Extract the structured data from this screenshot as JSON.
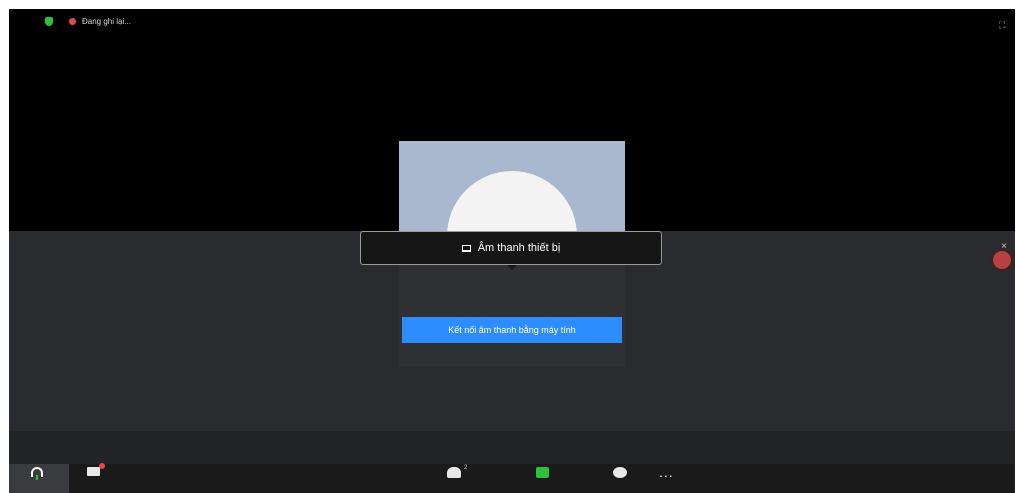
{
  "status": {
    "recording_label": "Đang ghi lại..."
  },
  "audio_popover": {
    "label": "Âm thanh thiết bị"
  },
  "join_audio": {
    "label": "Kết nối âm thanh bằng máy tính"
  },
  "toolbar": {
    "participants_count": "2",
    "more_label": "..."
  },
  "icons": {
    "security": "shield-icon",
    "recording": "record-dot-icon",
    "fullscreen": "fullscreen-icon",
    "audio": "headset-icon",
    "video": "camera-icon",
    "participants": "people-icon",
    "share": "share-screen-icon",
    "chat": "chat-icon",
    "more": "more-icon"
  },
  "colors": {
    "accent_blue": "#2d8cff",
    "status_green": "#2fbf3a",
    "status_red": "#e44a4a"
  }
}
